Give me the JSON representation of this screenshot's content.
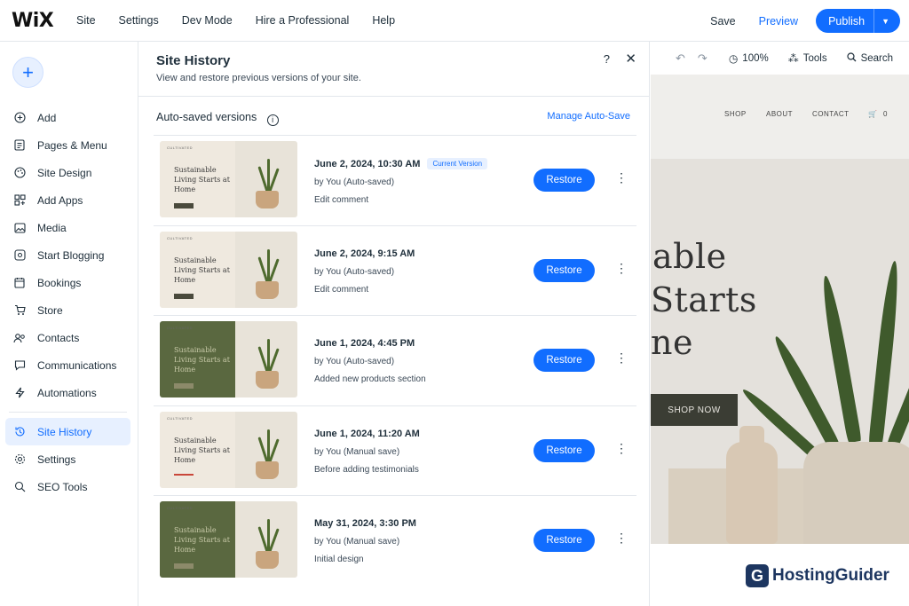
{
  "topbar": {
    "logo": "WiX",
    "nav": [
      "Site",
      "Settings",
      "Dev Mode",
      "Hire a Professional",
      "Help"
    ],
    "save": "Save",
    "preview": "Preview",
    "publish": "Publish"
  },
  "sidebar": {
    "add_symbol": "+",
    "items": [
      {
        "label": "Add",
        "icon": "plus-circle-icon"
      },
      {
        "label": "Pages & Menu",
        "icon": "pages-icon"
      },
      {
        "label": "Site Design",
        "icon": "palette-icon"
      },
      {
        "label": "Add Apps",
        "icon": "apps-icon"
      },
      {
        "label": "Media",
        "icon": "media-icon"
      },
      {
        "label": "Start Blogging",
        "icon": "blog-icon"
      },
      {
        "label": "Bookings",
        "icon": "calendar-icon"
      },
      {
        "label": "Store",
        "icon": "cart-icon"
      },
      {
        "label": "Contacts",
        "icon": "contacts-icon"
      },
      {
        "label": "Communications",
        "icon": "chat-icon"
      },
      {
        "label": "Automations",
        "icon": "bolt-icon"
      }
    ],
    "lower_items": [
      {
        "label": "Site History",
        "icon": "history-icon",
        "active": true
      },
      {
        "label": "Settings",
        "icon": "gear-icon"
      },
      {
        "label": "SEO Tools",
        "icon": "seo-search-icon"
      }
    ]
  },
  "panel": {
    "title": "Site History",
    "subtitle": "View and restore previous versions of your site.",
    "help": "?",
    "close": "✕",
    "auto_saved_label": "Auto-saved versions",
    "manage_link": "Manage Auto-Save",
    "restore_label": "Restore",
    "versions": [
      {
        "date": "June 2, 2024, 10:30 AM",
        "badge": "Current Version",
        "by": "by You (Auto-saved)",
        "note": "Edit comment",
        "thumb_style": "beige"
      },
      {
        "date": "June 2, 2024, 9:15 AM",
        "badge": "",
        "by": "by You (Auto-saved)",
        "note": "Edit comment",
        "thumb_style": "beige"
      },
      {
        "date": "June 1, 2024, 4:45 PM",
        "badge": "",
        "by": "by You (Auto-saved)",
        "note": "Added new products section",
        "thumb_style": "green"
      },
      {
        "date": "June 1, 2024, 11:20 AM",
        "badge": "",
        "by": "by You (Manual save)",
        "note": "Before adding testimonials",
        "thumb_style": "beige"
      },
      {
        "date": "May 31, 2024, 3:30 PM",
        "badge": "",
        "by": "by You (Manual save)",
        "note": "Initial design",
        "thumb_style": "green"
      }
    ],
    "thumb_brand": "CULTIVATED",
    "thumb_title": "Sustainable Living Starts at Home"
  },
  "canvas": {
    "zoom": "100%",
    "tools": "Tools",
    "search": "Search",
    "site_nav": [
      "SHOP",
      "ABOUT",
      "CONTACT",
      "0"
    ],
    "hero_lines": [
      "able",
      "Starts",
      "ne"
    ],
    "shop_now": "SHOP NOW"
  },
  "watermark": {
    "mark": "G",
    "text": "HostingGuider"
  },
  "colors": {
    "accent": "#116dff",
    "text": "#20303c",
    "badge_bg": "#e7f0ff"
  }
}
